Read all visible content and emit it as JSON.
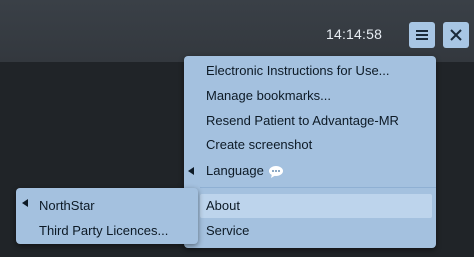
{
  "topbar": {
    "clock": "14:14:58",
    "menu_icon": "hamburger-menu-icon",
    "close_icon": "close-icon"
  },
  "menu": {
    "items": [
      {
        "label": "Electronic Instructions for Use..."
      },
      {
        "label": "Manage bookmarks..."
      },
      {
        "label": "Resend Patient to Advantage-MR"
      },
      {
        "label": "Create screenshot"
      },
      {
        "label": "Language",
        "icon": "speech-bubble-icon",
        "has_submenu": true
      },
      {
        "label": "About",
        "highlighted": true,
        "has_submenu": true
      },
      {
        "label": "Service"
      }
    ]
  },
  "submenu": {
    "items": [
      {
        "label": "NorthStar",
        "has_submenu": true
      },
      {
        "label": "Third Party Licences..."
      }
    ]
  },
  "colors": {
    "topbar": "#3a4047",
    "background": "#202428",
    "menu": "#a4c1df",
    "highlight": "#bdd4ec",
    "button": "#a8c6e4"
  }
}
